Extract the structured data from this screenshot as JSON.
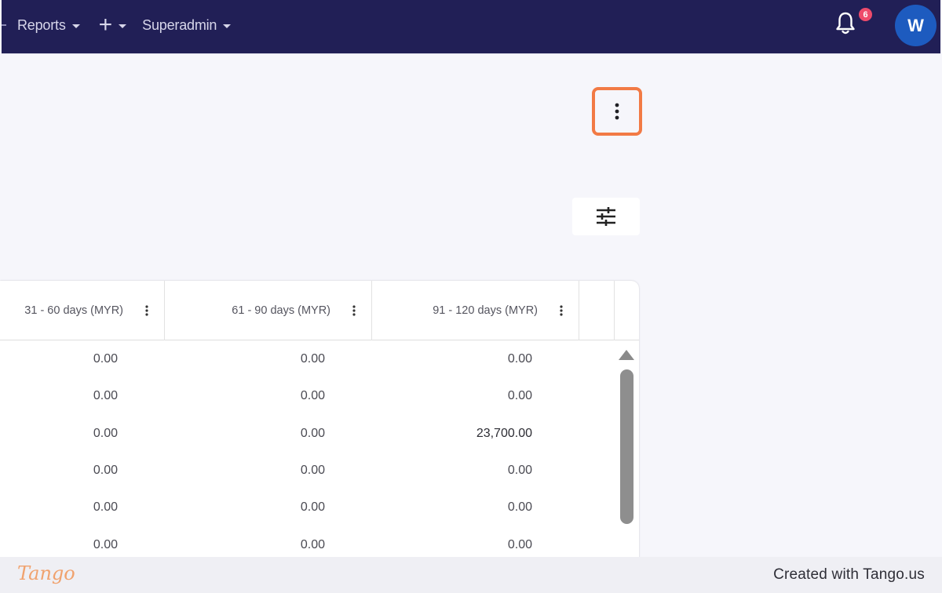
{
  "nav": {
    "reports_label": "Reports",
    "add_label": "+",
    "user_menu_label": "Superadmin",
    "notification_count": "6",
    "avatar_initial": "W"
  },
  "table": {
    "columns": [
      {
        "label": "31 - 60 days (MYR)"
      },
      {
        "label": "61 - 90 days (MYR)"
      },
      {
        "label": "91 - 120 days (MYR)"
      }
    ],
    "rows": [
      [
        "0.00",
        "0.00",
        "0.00"
      ],
      [
        "0.00",
        "0.00",
        "0.00"
      ],
      [
        "0.00",
        "0.00",
        "23,700.00"
      ],
      [
        "0.00",
        "0.00",
        "0.00"
      ],
      [
        "0.00",
        "0.00",
        "0.00"
      ],
      [
        "0.00",
        "0.00",
        "0.00"
      ]
    ]
  },
  "footer": {
    "logo_text": "Tango",
    "created_text": "Created with Tango.us"
  },
  "colors": {
    "topbar": "#211f56",
    "highlight": "#f27a45",
    "avatar": "#1d5bbf",
    "badge": "#ee4b6b"
  }
}
